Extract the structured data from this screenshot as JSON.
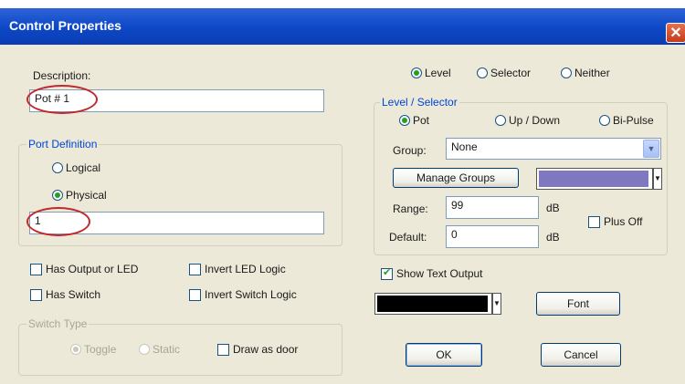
{
  "window": {
    "title": "Control Properties",
    "close_glyph": "✕"
  },
  "description": {
    "label": "Description:",
    "value": "Pot # 1"
  },
  "port_definition": {
    "legend": "Port Definition",
    "logical_label": "Logical",
    "physical_label": "Physical",
    "selected": "Physical",
    "value": "1"
  },
  "checkboxes": {
    "has_output_led": {
      "label": "Has Output or LED",
      "checked": false
    },
    "has_switch": {
      "label": "Has Switch",
      "checked": false
    },
    "invert_led": {
      "label": "Invert LED Logic",
      "checked": false
    },
    "invert_switch": {
      "label": "Invert Switch Logic",
      "checked": false
    }
  },
  "switch_type": {
    "legend": "Switch Type",
    "toggle_label": "Toggle",
    "static_label": "Static",
    "draw_as_door_label": "Draw as door",
    "selected": "Toggle",
    "enabled": false
  },
  "mode": {
    "level_label": "Level",
    "selector_label": "Selector",
    "neither_label": "Neither",
    "selected": "Level"
  },
  "level_selector": {
    "legend": "Level / Selector",
    "pot_label": "Pot",
    "updown_label": "Up / Down",
    "bipulse_label": "Bi-Pulse",
    "selected": "Pot",
    "group_label": "Group:",
    "group_value": "None",
    "manage_groups_label": "Manage Groups",
    "color_swatch": "#7f78c0",
    "range_label": "Range:",
    "range_value": "99",
    "range_unit": "dB",
    "default_label": "Default:",
    "default_value": "0",
    "default_unit": "dB",
    "plus_off_label": "Plus Off"
  },
  "text_output": {
    "show_label": "Show Text Output",
    "checked": true,
    "color_swatch": "#000000",
    "font_button": "Font"
  },
  "footer": {
    "ok_label": "OK",
    "cancel_label": "Cancel"
  },
  "colors": {
    "titlebar": "#0d47c6",
    "dialog_bg": "#ece9d8",
    "highlight_ellipse": "#c0292e",
    "legend_text": "#0046d5"
  },
  "icons": {
    "radio_selected": "radio-on-icon",
    "checkbox_checked": "check-icon",
    "dropdown": "chevron-down-icon"
  }
}
